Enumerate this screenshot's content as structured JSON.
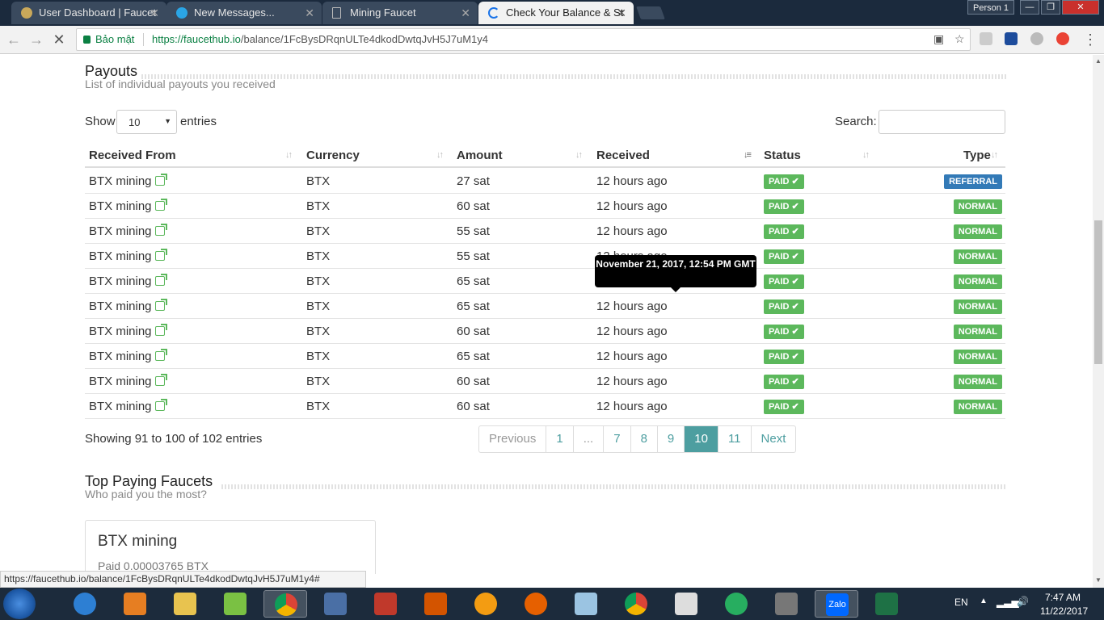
{
  "browser": {
    "tabs": [
      {
        "label": "User Dashboard | Faucet",
        "icon": "faucet-favicon-icon"
      },
      {
        "label": "New Messages...",
        "icon": "skype-icon"
      },
      {
        "label": "Mining Faucet",
        "icon": "document-icon"
      },
      {
        "label": "Check Your Balance & St",
        "icon": "loading-spinner-icon"
      }
    ],
    "profile": "Person 1",
    "security_label": "Bảo mật",
    "url_host": "https://faucethub.io",
    "url_path": "/balance/1FcBysDRqnULTe4dkodDwtqJvH5J7uM1y4"
  },
  "payouts": {
    "title": "Payouts",
    "subtitle": "List of individual payouts you received",
    "show_label": "Show",
    "entries_select": "10",
    "entries_label": "entries",
    "search_label": "Search:",
    "columns": [
      "Received From",
      "Currency",
      "Amount",
      "Received",
      "Status",
      "Type"
    ],
    "rows": [
      {
        "from": "BTX mining",
        "currency": "BTX",
        "amount": "27 sat",
        "received": "12 hours ago",
        "status": "PAID",
        "type": "REFERRAL"
      },
      {
        "from": "BTX mining",
        "currency": "BTX",
        "amount": "60 sat",
        "received": "12 hours ago",
        "status": "PAID",
        "type": "NORMAL"
      },
      {
        "from": "BTX mining",
        "currency": "BTX",
        "amount": "55 sat",
        "received": "12 hours ago",
        "status": "PAID",
        "type": "NORMAL"
      },
      {
        "from": "BTX mining",
        "currency": "BTX",
        "amount": "55 sat",
        "received": "12 hours ago",
        "status": "PAID",
        "type": "NORMAL"
      },
      {
        "from": "BTX mining",
        "currency": "BTX",
        "amount": "65 sat",
        "received": "12 hours ago",
        "status": "PAID",
        "type": "NORMAL"
      },
      {
        "from": "BTX mining",
        "currency": "BTX",
        "amount": "65 sat",
        "received": "12 hours ago",
        "status": "PAID",
        "type": "NORMAL"
      },
      {
        "from": "BTX mining",
        "currency": "BTX",
        "amount": "60 sat",
        "received": "12 hours ago",
        "status": "PAID",
        "type": "NORMAL"
      },
      {
        "from": "BTX mining",
        "currency": "BTX",
        "amount": "65 sat",
        "received": "12 hours ago",
        "status": "PAID",
        "type": "NORMAL"
      },
      {
        "from": "BTX mining",
        "currency": "BTX",
        "amount": "60 sat",
        "received": "12 hours ago",
        "status": "PAID",
        "type": "NORMAL"
      },
      {
        "from": "BTX mining",
        "currency": "BTX",
        "amount": "60 sat",
        "received": "12 hours ago",
        "status": "PAID",
        "type": "NORMAL"
      }
    ],
    "tooltip": "November 21, 2017, 12:54 PM GMT",
    "info": "Showing 91 to 100 of 102 entries",
    "pagination": [
      "Previous",
      "1",
      "...",
      "7",
      "8",
      "9",
      "10",
      "11",
      "Next"
    ],
    "current_page": "10"
  },
  "top_faucets": {
    "title": "Top Paying Faucets",
    "subtitle": "Who paid you the most?",
    "card_title": "BTX mining",
    "card_sub": "Paid 0.00003765 BTX"
  },
  "status_url": "https://faucethub.io/balance/1FcBysDRqnULTe4dkodDwtqJvH5J7uM1y4#",
  "taskbar": {
    "lang": "EN",
    "time": "7:47 AM",
    "date": "11/22/2017",
    "zalo": "Zalo"
  },
  "colors": {
    "paid": "#5cb85c",
    "referral": "#337ab7",
    "normal": "#5cb85c",
    "accent": "#4d9ea0"
  }
}
